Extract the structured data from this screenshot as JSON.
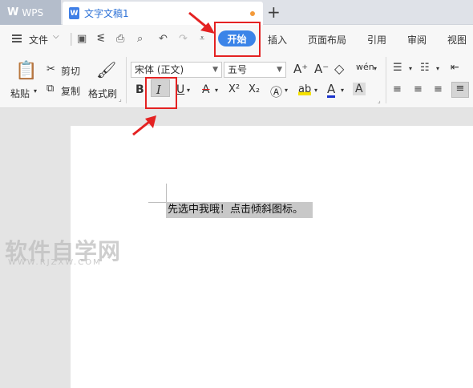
{
  "titlebar": {
    "app_tab": "WPS",
    "doc_tab": "文字文稿1",
    "add_tab": "+"
  },
  "menu": {
    "file": "文件",
    "tabs": [
      "开始",
      "插入",
      "页面布局",
      "引用",
      "审阅",
      "视图"
    ]
  },
  "ribbon": {
    "paste": "粘贴",
    "cut": "剪切",
    "copy": "复制",
    "format_painter": "格式刷",
    "font_name": "宋体 (正文)",
    "font_size": "五号",
    "bold": "B",
    "italic": "I",
    "underline": "U",
    "strikethrough": "A",
    "superscript": "X²",
    "subscript": "X₂",
    "font_color": "A",
    "char_shading": "A",
    "highlight": "ab",
    "grow_font": "A⁺",
    "shrink_font": "A⁻",
    "phonetic": "wén"
  },
  "document": {
    "selected_text": "先选中我哦！点击倾斜图标。"
  },
  "watermark": {
    "main": "软件自学网",
    "sub": "WWW.RJZXW.COM"
  },
  "colors": {
    "accent": "#3b84e8",
    "annotation_red": "#e42222",
    "selection": "#c8c8c8"
  }
}
